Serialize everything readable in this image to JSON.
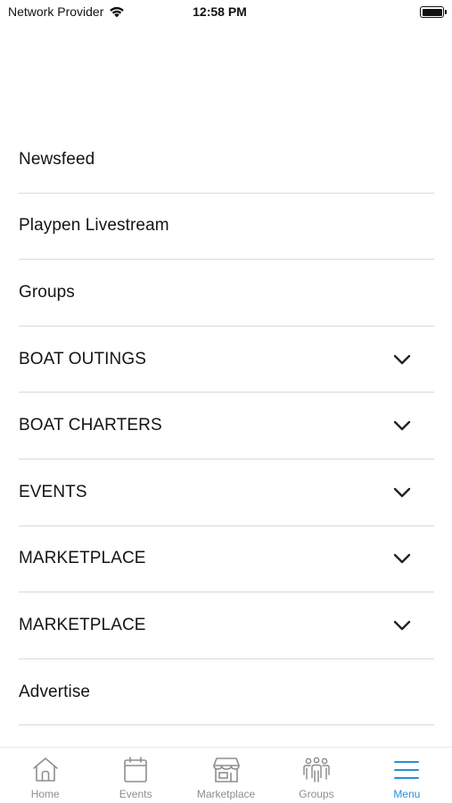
{
  "status_bar": {
    "carrier": "Network Provider",
    "time": "12:58 PM"
  },
  "menu": {
    "items": [
      {
        "label": "Newsfeed",
        "expandable": false
      },
      {
        "label": "Playpen Livestream",
        "expandable": false
      },
      {
        "label": "Groups",
        "expandable": false
      },
      {
        "label": "BOAT OUTINGS",
        "expandable": true
      },
      {
        "label": "BOAT CHARTERS",
        "expandable": true
      },
      {
        "label": "EVENTS",
        "expandable": true
      },
      {
        "label": "MARKETPLACE",
        "expandable": true
      },
      {
        "label": "MARKETPLACE",
        "expandable": true
      },
      {
        "label": "Advertise",
        "expandable": false
      }
    ]
  },
  "tab_bar": {
    "tabs": [
      {
        "label": "Home",
        "icon": "home-icon",
        "active": false
      },
      {
        "label": "Events",
        "icon": "calendar-icon",
        "active": false
      },
      {
        "label": "Marketplace",
        "icon": "storefront-icon",
        "active": false
      },
      {
        "label": "Groups",
        "icon": "people-icon",
        "active": false
      },
      {
        "label": "Menu",
        "icon": "hamburger-menu-icon",
        "active": true
      }
    ]
  },
  "colors": {
    "accent": "#2a8fd8",
    "inactive": "#8e8e8e",
    "divider": "#d9d9d9"
  }
}
